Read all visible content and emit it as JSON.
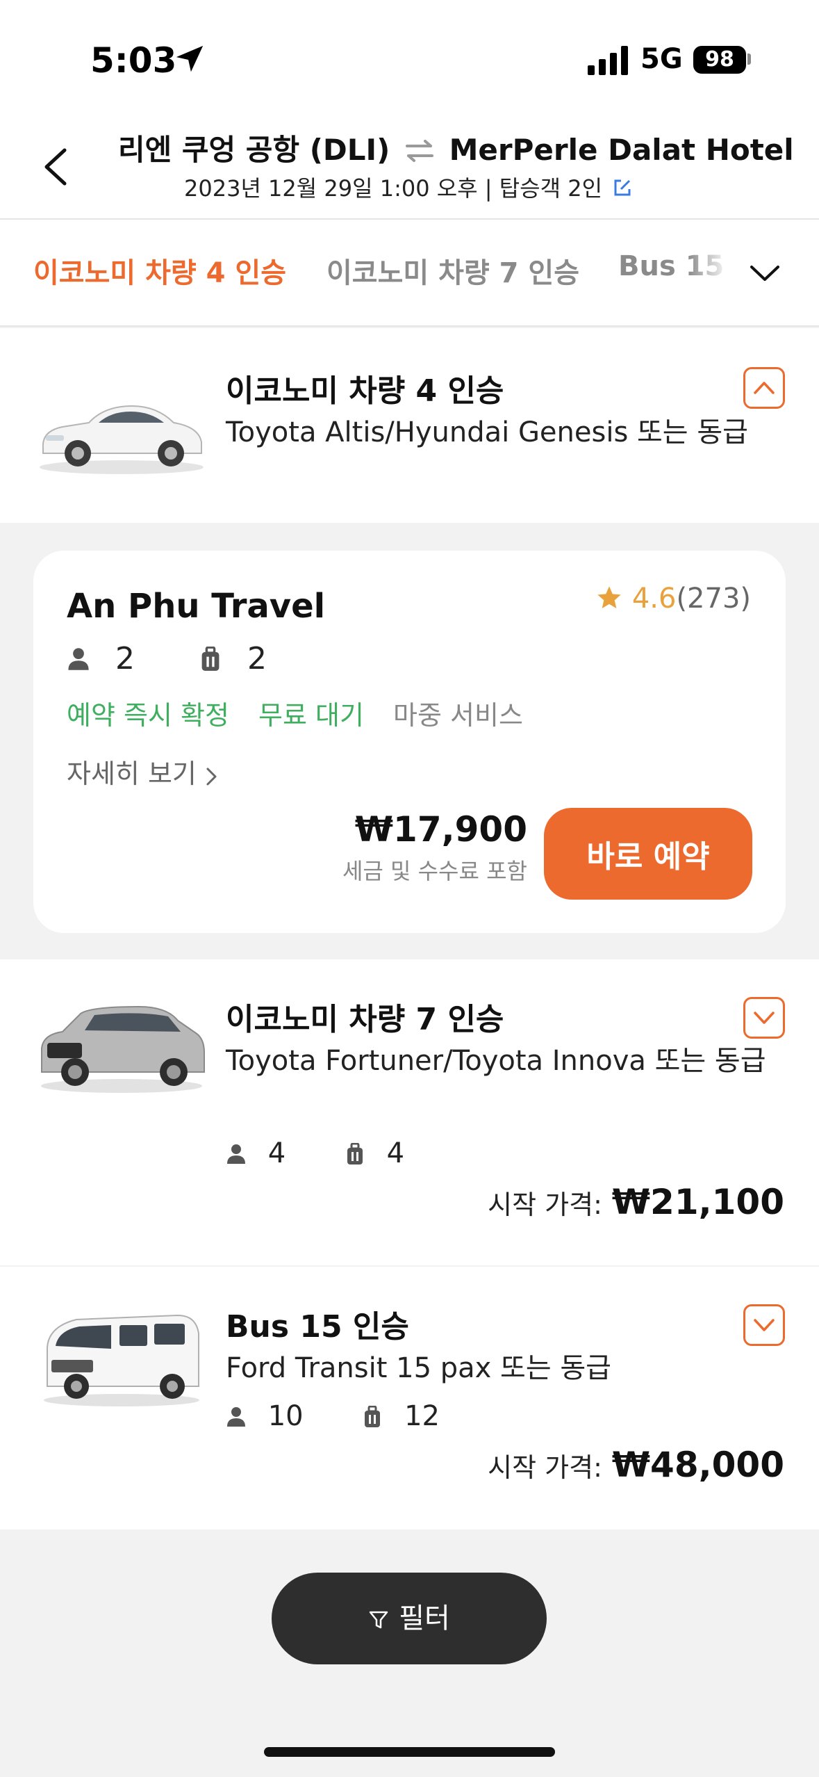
{
  "status_bar": {
    "time": "5:03",
    "network": "5G",
    "battery": "98"
  },
  "header": {
    "origin": "리엔 쿠엉 공항 (DLI)",
    "destination": "MerPerle Dalat Hotel",
    "subtitle": "2023년 12월 29일 1:00 오후 | 탑승객 2인"
  },
  "tabs": [
    "이코노미 차량 4 인승",
    "이코노미 차량 7 인승",
    "Bus 15"
  ],
  "vehicles": [
    {
      "title": "이코노미 차량 4 인승",
      "description": "Toyota Altis/Hyundai Genesis 또는 동급",
      "expanded": true
    },
    {
      "title": "이코노미 차량 7 인승",
      "description": "Toyota Fortuner/Toyota Innova 또는 동급",
      "passengers": "4",
      "luggage": "4",
      "price_label": "시작 가격:",
      "price": "₩21,100"
    },
    {
      "title": "Bus 15 인승",
      "description": "Ford Transit 15 pax 또는 동급",
      "passengers": "10",
      "luggage": "12",
      "price_label": "시작 가격:",
      "price": "₩48,000"
    }
  ],
  "offer": {
    "provider": "An Phu Travel",
    "rating": "4.6",
    "reviews": "(273)",
    "passengers": "2",
    "luggage": "2",
    "tags_green": [
      "예약 즉시 확정",
      "무료 대기"
    ],
    "tag_gray": "마중 서비스",
    "details_label": "자세히 보기",
    "price": "₩17,900",
    "price_note": "세금 및 수수료 포함",
    "book_label": "바로 예약"
  },
  "filter_label": "필터",
  "colors": {
    "accent": "#ec6a2e",
    "green": "#3fae5f",
    "star": "#e9a23b",
    "dark": "#2e2e2e"
  }
}
